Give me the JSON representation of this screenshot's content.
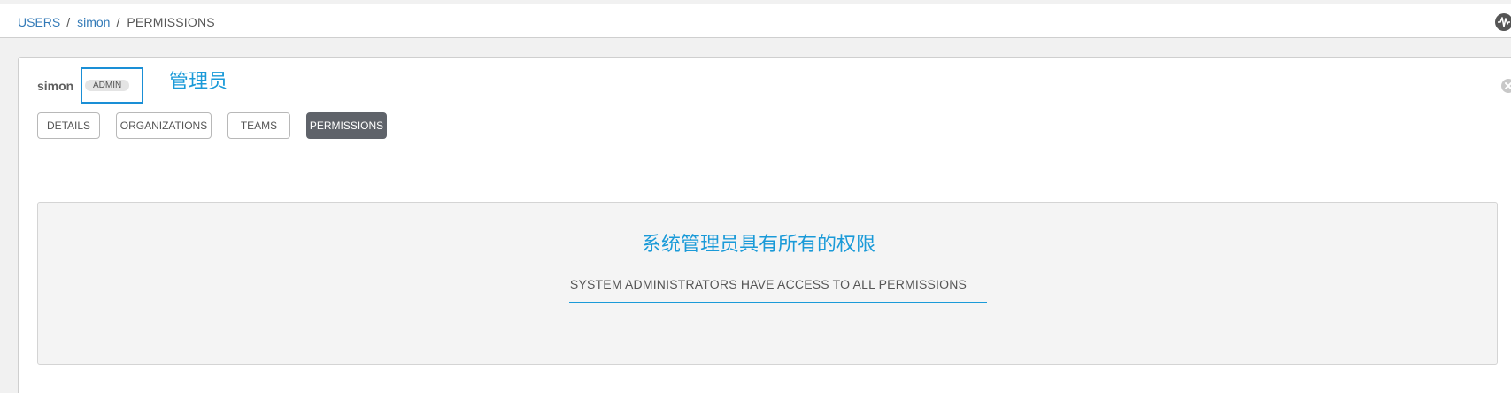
{
  "breadcrumb": {
    "users": "USERS",
    "separator": "/",
    "user": "simon",
    "current": "PERMISSIONS"
  },
  "icons": {
    "activity": "activity-stream-icon",
    "close": "close-icon"
  },
  "user": {
    "name": "simon",
    "badge": "ADMIN",
    "badge_annotation": "管理员"
  },
  "tabs": [
    {
      "label": "DETAILS",
      "active": false
    },
    {
      "label": "ORGANIZATIONS",
      "active": false
    },
    {
      "label": "TEAMS",
      "active": false
    },
    {
      "label": "PERMISSIONS",
      "active": true
    }
  ],
  "notice": {
    "annotation": "系统管理员具有所有的权限",
    "text": "SYSTEM ADMINISTRATORS HAVE ACCESS TO ALL PERMISSIONS"
  },
  "colors": {
    "link": "#337ab7",
    "annotation": "#1a9ad8",
    "active_tab": "#5f636a"
  }
}
